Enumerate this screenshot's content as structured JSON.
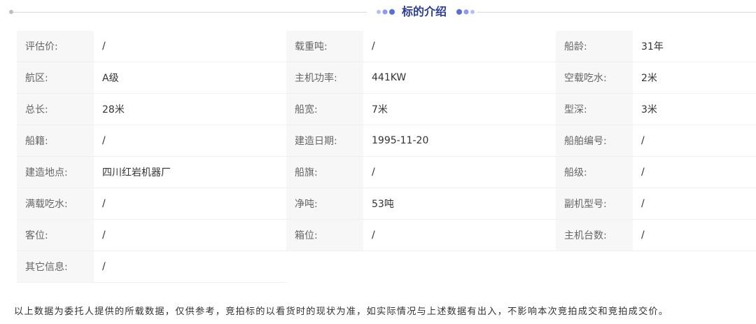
{
  "section": {
    "title": "标的介绍"
  },
  "colors": {
    "title": "#2c3e94",
    "accent_dot_dark": "#5b6fd6",
    "accent_dot_light": "#b8c2f0",
    "label_bg": "#f7f7f7"
  },
  "rows": [
    [
      {
        "label": "评估价:",
        "value": "/"
      },
      {
        "label": "载重吨:",
        "value": "/"
      },
      {
        "label": "船龄:",
        "value": "31年"
      }
    ],
    [
      {
        "label": "航区:",
        "value": "A级"
      },
      {
        "label": "主机功率:",
        "value": "441KW"
      },
      {
        "label": "空载吃水:",
        "value": "2米"
      }
    ],
    [
      {
        "label": "总长:",
        "value": "28米"
      },
      {
        "label": "船宽:",
        "value": "7米"
      },
      {
        "label": "型深:",
        "value": "3米"
      }
    ],
    [
      {
        "label": "船籍:",
        "value": "/"
      },
      {
        "label": "建造日期:",
        "value": "1995-11-20"
      },
      {
        "label": "船舶编号:",
        "value": "/"
      }
    ],
    [
      {
        "label": "建造地点:",
        "value": "四川红岩机器厂"
      },
      {
        "label": "船旗:",
        "value": "/"
      },
      {
        "label": "船级:",
        "value": "/"
      }
    ],
    [
      {
        "label": "满载吃水:",
        "value": "/"
      },
      {
        "label": "净吨:",
        "value": "53吨"
      },
      {
        "label": "副机型号:",
        "value": "/"
      }
    ],
    [
      {
        "label": "客位:",
        "value": "/"
      },
      {
        "label": "箱位:",
        "value": "/"
      },
      {
        "label": "主机台数:",
        "value": "/"
      }
    ],
    [
      {
        "label": "其它信息:",
        "value": "/"
      }
    ]
  ],
  "disclaimer": "以上数据为委托人提供的所载数据，仅供参考，竞拍标的以看货时的现状为准，如实际情况与上述数据有出入，不影响本次竞拍成交和竞拍成交价。"
}
